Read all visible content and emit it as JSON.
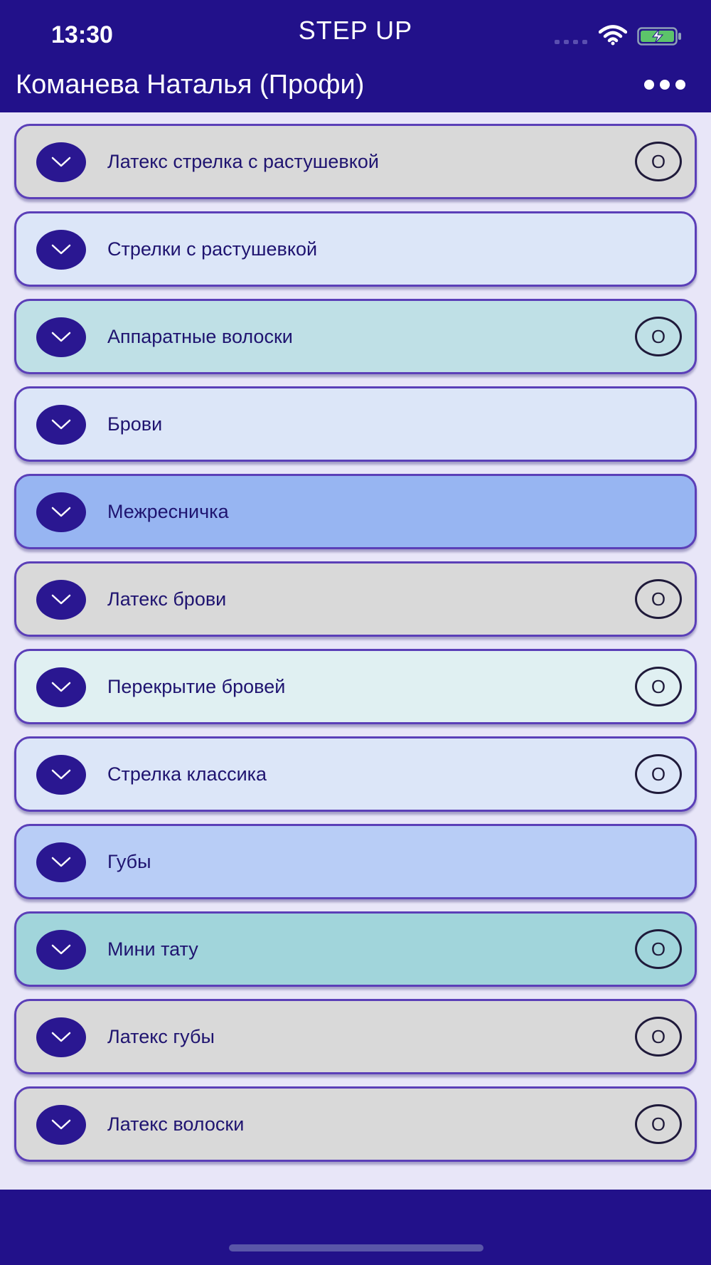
{
  "status_bar": {
    "time": "13:30",
    "app_name": "STEP UP",
    "wifi_icon": "wifi-icon",
    "battery_icon": "battery-charging-icon"
  },
  "header": {
    "title": "Команева Наталья (Профи)",
    "more_icon": "more-dots-icon"
  },
  "colors": {
    "brand": "#22118a",
    "background": "#e8e6f8",
    "item_border": "#5b3fb8",
    "label_text": "#1f1470"
  },
  "items": [
    {
      "label": "Латекс стрелка с растушевкой",
      "badge": "О",
      "bg": "#d9d9d9"
    },
    {
      "label": "Стрелки с растушевкой",
      "badge": "",
      "bg": "#dce6f8"
    },
    {
      "label": "Аппаратные волоски",
      "badge": "О",
      "bg": "#bfe0e6"
    },
    {
      "label": "Брови",
      "badge": "",
      "bg": "#dce6f8"
    },
    {
      "label": "Межресничка",
      "badge": "",
      "bg": "#97b5f2"
    },
    {
      "label": "Латекс брови",
      "badge": "О",
      "bg": "#d9d9d9"
    },
    {
      "label": "Перекрытие бровей",
      "badge": "О",
      "bg": "#e0f0f2"
    },
    {
      "label": "Стрелка классика",
      "badge": "О",
      "bg": "#dce6f8"
    },
    {
      "label": "Губы",
      "badge": "",
      "bg": "#b8cdf6"
    },
    {
      "label": "Мини тату",
      "badge": "О",
      "bg": "#a1d5db"
    },
    {
      "label": "Латекс губы",
      "badge": "О",
      "bg": "#d9d9d9"
    },
    {
      "label": "Латекс волоски",
      "badge": "О",
      "bg": "#d9d9d9"
    }
  ]
}
